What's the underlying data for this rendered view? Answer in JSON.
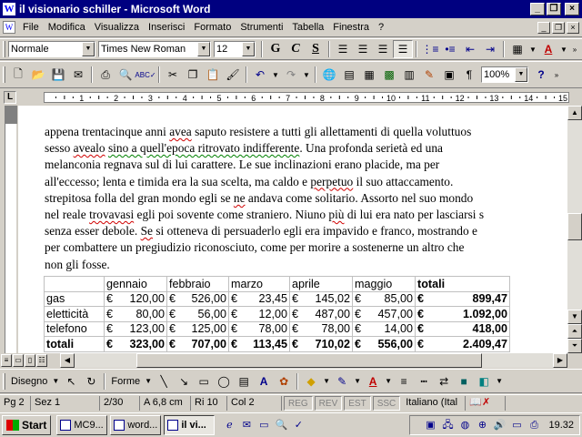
{
  "window": {
    "title": "il visionario schiller - Microsoft Word",
    "minimize_glyph": "_",
    "maximize_glyph": "❐",
    "close_glyph": "×"
  },
  "menubar": {
    "items": [
      "File",
      "Modifica",
      "Visualizza",
      "Inserisci",
      "Formato",
      "Strumenti",
      "Tabella",
      "Finestra",
      "?"
    ]
  },
  "formatting_toolbar": {
    "style": "Normale",
    "font": "Times New Roman",
    "size": "12",
    "bold": "G",
    "italic": "C",
    "underline": "S"
  },
  "standard_toolbar": {
    "zoom": "100%",
    "help": "?"
  },
  "ruler": {
    "tab_selector": "L",
    "numbers": [
      "1",
      "2",
      "3",
      "4",
      "5",
      "6",
      "7",
      "8",
      "9",
      "10",
      "11",
      "12",
      "13",
      "14",
      "15"
    ]
  },
  "document": {
    "lines": [
      [
        {
          "t": "appena trentacinque anni "
        },
        {
          "t": "avea",
          "s": "sq"
        },
        {
          "t": " saputo resistere a tutti gli allettamenti di quella voluttuos"
        }
      ],
      [
        {
          "t": "sesso "
        },
        {
          "t": "avealo",
          "s": "sq"
        },
        {
          "t": " "
        },
        {
          "t": "sino a quell'epoca ritrovato indifferente",
          "s": "sg"
        },
        {
          "t": ". Una profonda serietà ed una"
        }
      ],
      [
        {
          "t": "melanconia regnava sul di lui carattere. Le sue inclinazioni erano placide, ma per"
        }
      ],
      [
        {
          "t": "all'eccesso; lenta e timida era la sua scelta, ma caldo e "
        },
        {
          "t": "perpetuo",
          "s": "sq"
        },
        {
          "t": " il suo attaccamento. "
        }
      ],
      [
        {
          "t": "strepitosa folla del gran mondo egli se "
        },
        {
          "t": "ne",
          "s": "sq"
        },
        {
          "t": " andava come solitario. Assorto nel suo mondo"
        }
      ],
      [
        {
          "t": "nel reale "
        },
        {
          "t": "trovavasi",
          "s": "sq"
        },
        {
          "t": " egli poi sovente come straniero. Niuno "
        },
        {
          "t": "più",
          "s": "sq"
        },
        {
          "t": " di lui era nato per lasciarsi s"
        }
      ],
      [
        {
          "t": "senza esser debole. "
        },
        {
          "t": "Se",
          "s": "sq"
        },
        {
          "t": " si otteneva di persuaderlo egli era impavido e franco, mostrando e"
        }
      ],
      [
        {
          "t": "per combattere un pregiudizio riconosciuto, come per morire a sostenerne un altro che"
        }
      ],
      [
        {
          "t": "non gli fosse."
        }
      ]
    ],
    "table": {
      "headers": [
        "",
        "gennaio",
        "febbraio",
        "marzo",
        "aprile",
        "maggio",
        "totali"
      ],
      "rows": [
        {
          "label": "gas",
          "values": [
            "120,00",
            "526,00",
            "23,45",
            "145,02",
            "85,00"
          ],
          "total": "899,47"
        },
        {
          "label": "eletticità",
          "values": [
            "80,00",
            "56,00",
            "12,00",
            "487,00",
            "457,00"
          ],
          "total": "1.092,00"
        },
        {
          "label": "telefono",
          "values": [
            "123,00",
            "125,00",
            "78,00",
            "78,00",
            "14,00"
          ],
          "total": "418,00"
        },
        {
          "label": "totali",
          "values": [
            "323,00",
            "707,00",
            "113,45",
            "710,02",
            "556,00"
          ],
          "total": "2.409,47"
        }
      ],
      "currency": "€"
    }
  },
  "drawing_toolbar": {
    "draw": "Disegno",
    "shapes": "Forme"
  },
  "statusbar": {
    "page": "Pg 2",
    "section": "Sez 1",
    "pages": "2/30",
    "position": "A 6,8 cm",
    "row": "Ri 10",
    "col": "Col 2",
    "rec": "REG",
    "rev": "REV",
    "ext": "EST",
    "ovr": "SSC",
    "language": "Italiano (Ital"
  },
  "taskbar": {
    "start": "Start",
    "tasks": [
      "MC9...",
      "word...",
      "il vi..."
    ],
    "clock": "19.32"
  }
}
